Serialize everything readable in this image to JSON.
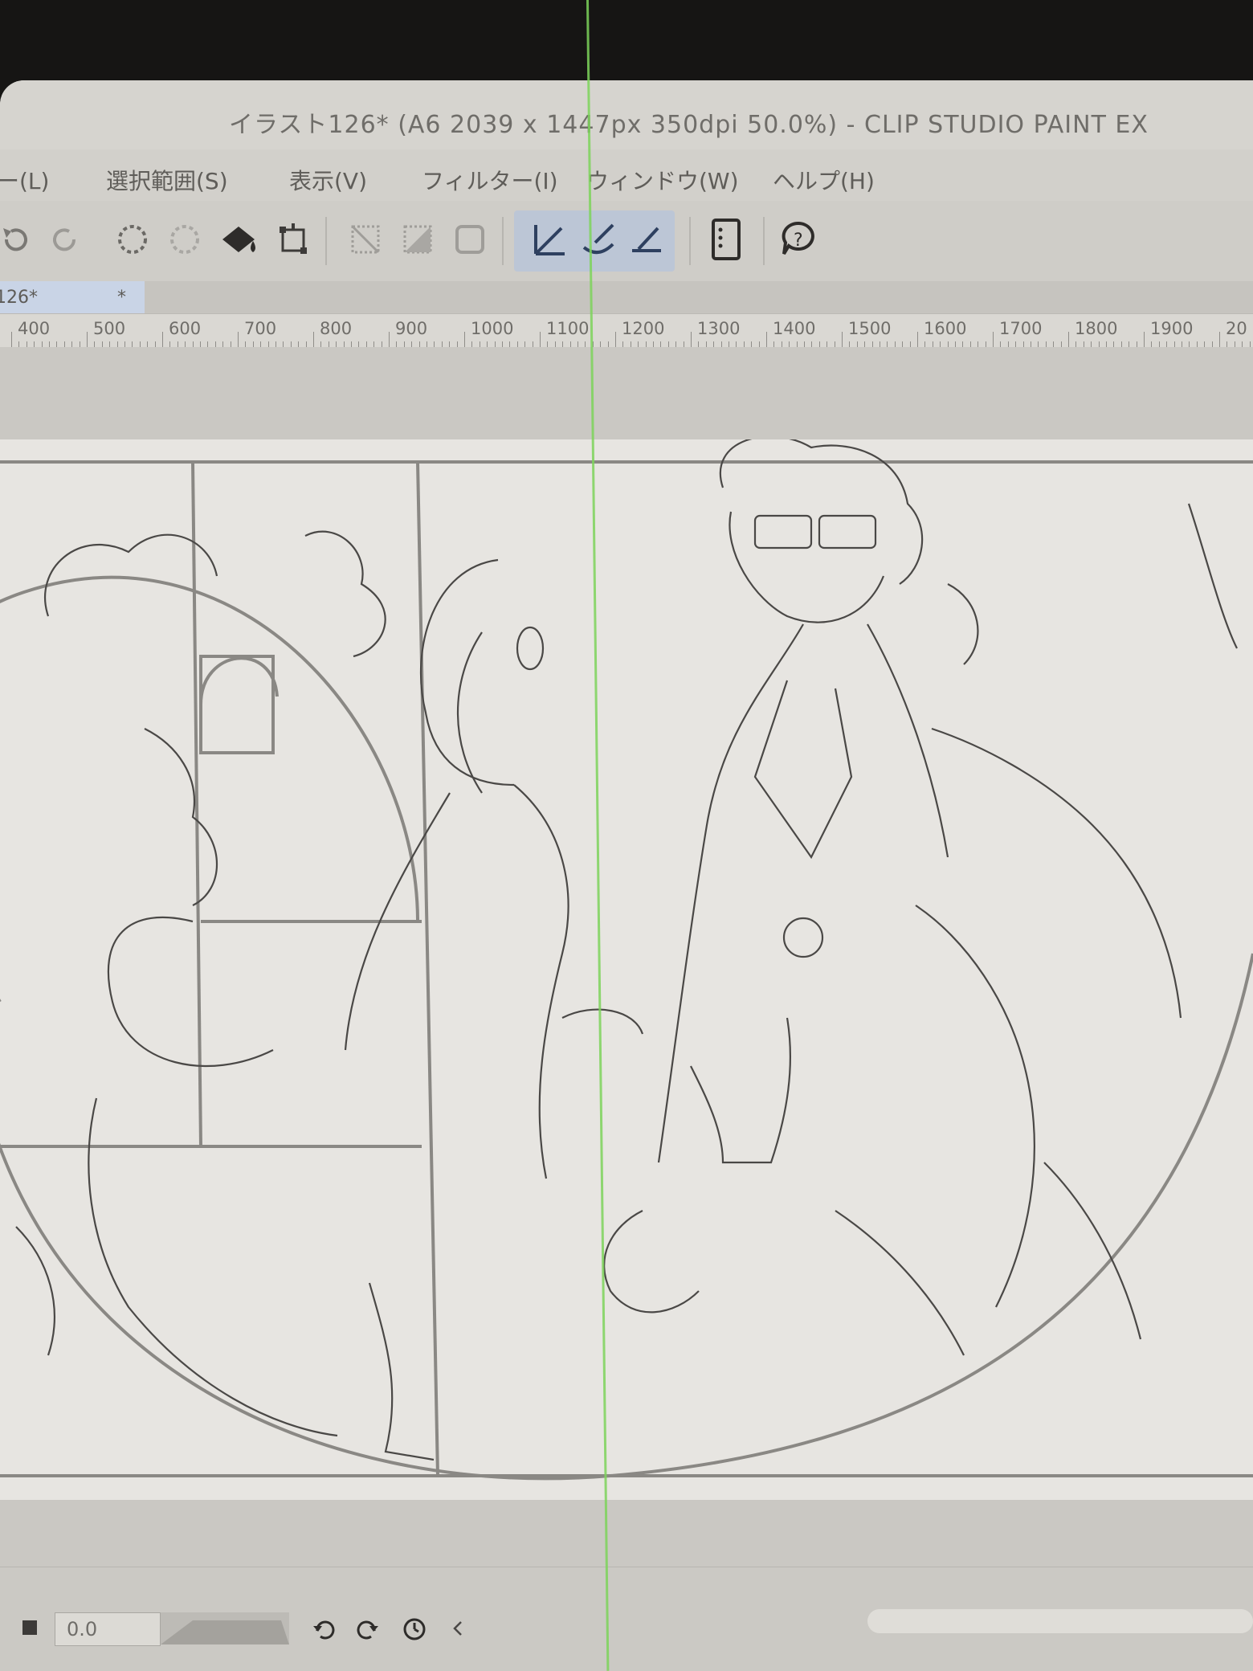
{
  "window": {
    "title": "イラスト126* (A6 2039 x 1447px 350dpi 50.0%)  - CLIP STUDIO PAINT EX"
  },
  "menubar": {
    "items": [
      {
        "label": "ー(L)"
      },
      {
        "label": "選択範囲(S)"
      },
      {
        "label": "表示(V)"
      },
      {
        "label": "フィルター(I)"
      },
      {
        "label": "ウィンドウ(W)"
      },
      {
        "label": "ヘルプ(H)"
      }
    ]
  },
  "toolbar": {
    "icons": [
      "undo-icon",
      "redo-icon",
      "selection-lasso-icon",
      "selection-fade-icon",
      "fill-icon",
      "transform-icon",
      "clear-icon",
      "tone-icon",
      "border-icon",
      "line-snap-icon",
      "curve-snap-icon",
      "ruler-snap-icon",
      "tablet-icon",
      "help-icon"
    ]
  },
  "document_tab": {
    "label": "126*",
    "modified_marker": "*"
  },
  "ruler": {
    "labels": [
      "400",
      "500",
      "600",
      "700",
      "800",
      "900",
      "1000",
      "1100",
      "1200",
      "1300",
      "1400",
      "1500",
      "1600",
      "1700",
      "1800",
      "1900",
      "20"
    ]
  },
  "bottom": {
    "value": "0.0"
  },
  "colors": {
    "selected_group": "#bcc6d6",
    "guide_line": "#7cd45a",
    "artboard": "#e7e5e1"
  }
}
